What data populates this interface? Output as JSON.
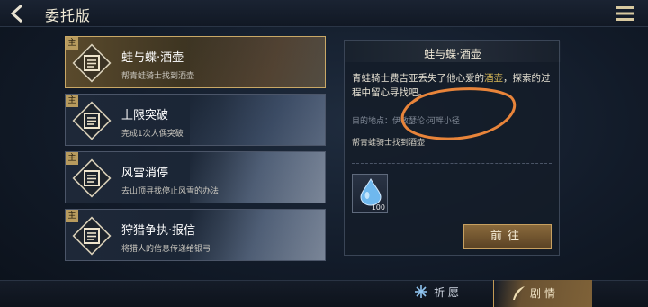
{
  "header": {
    "title": "委托版",
    "back_icon": "back-arrow-icon",
    "menu_icon": "menu-icon"
  },
  "quests": [
    {
      "tag": "主",
      "name": "蛙与蝶·酒壶",
      "desc": "帮青蛙骑士找到酒壶",
      "selected": true
    },
    {
      "tag": "主",
      "name": "上限突破",
      "desc": "完成1次人偶突破",
      "selected": false
    },
    {
      "tag": "主",
      "name": "风雪消停",
      "desc": "去山顶寻找停止风雪的办法",
      "selected": false
    },
    {
      "tag": "主",
      "name": "狩猎争执·报信",
      "desc": "将猎人的信息传递给银弓",
      "selected": false
    }
  ],
  "detail": {
    "title": "蛙与蝶·酒壶",
    "story_before": "青蛙骑士费吉亚丢失了他心爱的",
    "story_highlight": "酒壶",
    "story_after": "，探索的过程中留心寻找吧。",
    "destination": "目的地点：伊敏瑟伦·河畔小径",
    "task": "帮青蛙骑士找到酒壶",
    "reward_quantity": "100",
    "go_button": "前往"
  },
  "bottom_tabs": {
    "pray": "祈愿",
    "story": "剧情"
  },
  "colors": {
    "accent_gold": "#c9a866",
    "highlight_text": "#d2b456",
    "annotation": "#e8843a"
  }
}
